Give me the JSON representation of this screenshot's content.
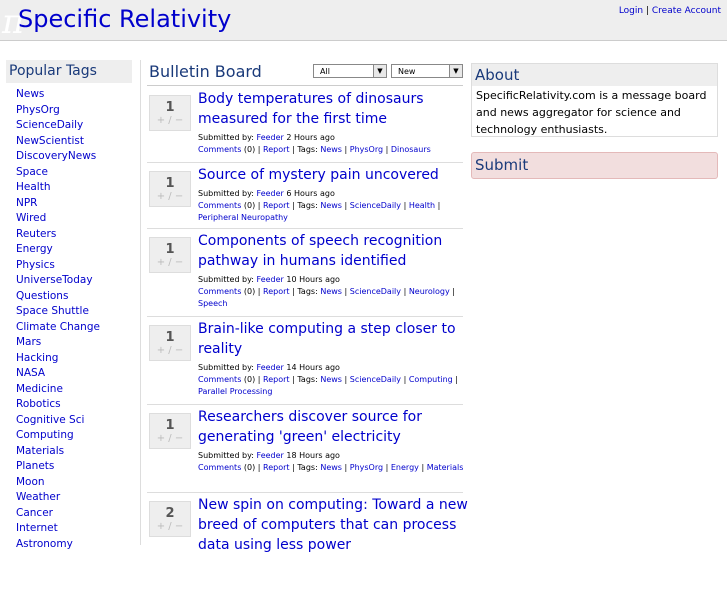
{
  "header": {
    "logo_mark": "π",
    "title": "Specific Relativity",
    "login": "Login",
    "separator": "|",
    "create_account": "Create Account"
  },
  "sidebar": {
    "title": "Popular Tags",
    "tags": [
      "News",
      "PhysOrg",
      "ScienceDaily",
      "NewScientist",
      "DiscoveryNews",
      "Space",
      "Health",
      "NPR",
      "Wired",
      "Reuters",
      "Energy",
      "Physics",
      "UniverseToday",
      "Questions",
      "Space Shuttle",
      "Climate Change",
      "Mars",
      "Hacking",
      "NASA",
      "Medicine",
      "Robotics",
      "Cognitive Sci",
      "Computing",
      "Materials",
      "Planets",
      "Moon",
      "Weather",
      "Cancer",
      "Internet",
      "Astronomy"
    ]
  },
  "board": {
    "title": "Bulletin Board",
    "filter_value": "All",
    "sort_value": "New",
    "dropdown_arrow": "▼"
  },
  "posts": [
    {
      "votes": "1",
      "vote_controls": "+ / −",
      "title": "Body temperatures of dinosaurs measured for the first time",
      "submitted_by": "Submitted by:",
      "author": "Feeder",
      "time": "2 Hours ago",
      "comments": "Comments",
      "comment_count": "(0) |",
      "report": "Report",
      "tags_label": "| Tags:",
      "tags": [
        "News",
        "PhysOrg",
        "Dinosaurs"
      ]
    },
    {
      "votes": "1",
      "vote_controls": "+ / −",
      "title": "Source of mystery pain uncovered",
      "submitted_by": "Submitted by:",
      "author": "Feeder",
      "time": "6 Hours ago",
      "comments": "Comments",
      "comment_count": "(0) |",
      "report": "Report",
      "tags_label": "| Tags:",
      "tags": [
        "News",
        "ScienceDaily",
        "Health",
        "Peripheral Neuropathy"
      ]
    },
    {
      "votes": "1",
      "vote_controls": "+ / −",
      "title": "Components of speech recognition pathway in humans identified",
      "submitted_by": "Submitted by:",
      "author": "Feeder",
      "time": "10 Hours ago",
      "comments": "Comments",
      "comment_count": "(0) |",
      "report": "Report",
      "tags_label": "| Tags:",
      "tags": [
        "News",
        "ScienceDaily",
        "Neurology",
        "Speech"
      ]
    },
    {
      "votes": "1",
      "vote_controls": "+ / −",
      "title": "Brain-like computing a step closer to reality",
      "submitted_by": "Submitted by:",
      "author": "Feeder",
      "time": "14 Hours ago",
      "comments": "Comments",
      "comment_count": "(0) |",
      "report": "Report",
      "tags_label": "| Tags:",
      "tags": [
        "News",
        "ScienceDaily",
        "Computing",
        "Parallel Processing"
      ]
    },
    {
      "votes": "1",
      "vote_controls": "+ / −",
      "title": "Researchers discover source for generating 'green' electricity",
      "submitted_by": "Submitted by:",
      "author": "Feeder",
      "time": "18 Hours ago",
      "comments": "Comments",
      "comment_count": "(0) |",
      "report": "Report",
      "tags_label": "| Tags:",
      "tags": [
        "News",
        "PhysOrg",
        "Energy",
        "Materials"
      ]
    },
    {
      "votes": "2",
      "vote_controls": "+ / −",
      "title": "New spin on computing: Toward a new breed of computers that can process data using less power"
    }
  ],
  "about": {
    "title": "About",
    "text": "SpecificRelativity.com is a message board and news aggregator for science and technology enthusiasts."
  },
  "submit": {
    "title": "Submit"
  }
}
